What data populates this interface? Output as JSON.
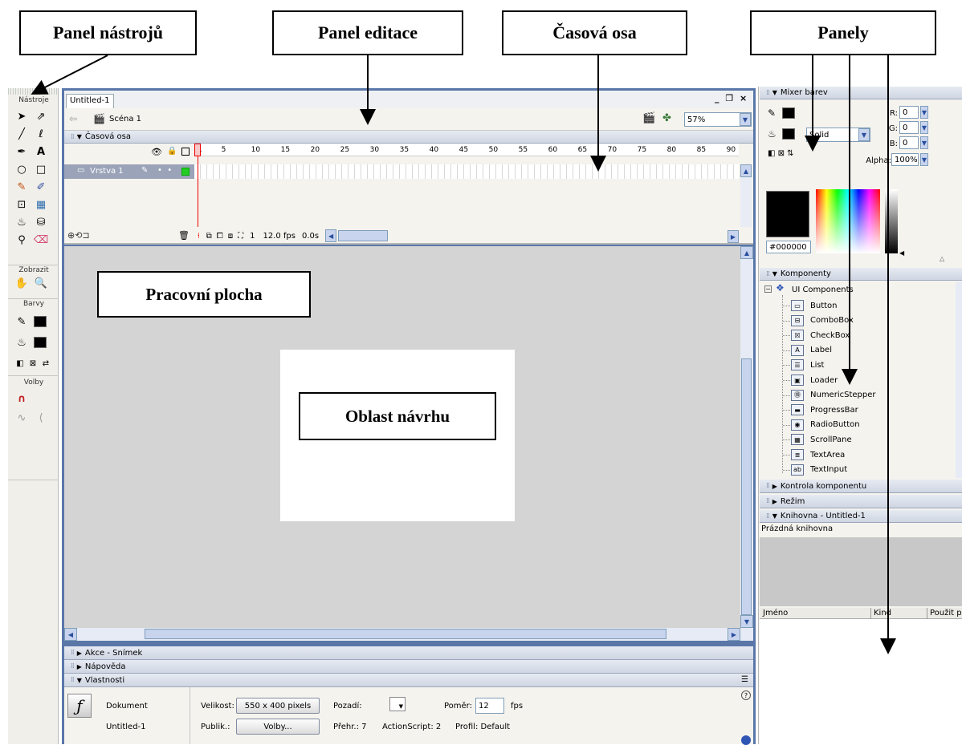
{
  "callouts": {
    "tools_panel": "Panel nástrojů",
    "edit_panel": "Panel editace",
    "timeline": "Časová osa",
    "panels": "Panely",
    "workspace": "Pracovní plocha",
    "design_area": "Oblast návrhu"
  },
  "toolbox": {
    "title": "Nástroje",
    "view_label": "Zobrazit",
    "colors_label": "Barvy",
    "options_label": "Volby"
  },
  "document": {
    "tab": "Untitled-1",
    "scene": "Scéna 1",
    "zoom": "57%",
    "window_controls": "_ ❐ ×"
  },
  "timeline": {
    "title": "Časová osa",
    "layer": "Vrstva 1",
    "frames": [
      "1",
      "5",
      "10",
      "15",
      "20",
      "25",
      "30",
      "35",
      "40",
      "45",
      "50",
      "55",
      "60",
      "65",
      "70",
      "75",
      "80",
      "85",
      "90"
    ],
    "current_frame": "1",
    "fps": "12.0 fps",
    "time": "0.0s"
  },
  "bottom_panels": {
    "actions": "Akce - Snímek",
    "help": "Nápověda",
    "properties": "Vlastnosti"
  },
  "properties": {
    "doc_label": "Dokument",
    "doc_name": "Untitled-1",
    "size_label": "Velikost:",
    "size_value": "550 x 400 pixels",
    "background_label": "Pozadí:",
    "ratio_label": "Poměr:",
    "ratio_value": "12",
    "fps_label": "fps",
    "publish_label": "Publik.:",
    "options_button": "Volby...",
    "player": "Přehr.: 7",
    "actionscript": "ActionScript: 2",
    "profile": "Profil:  Default"
  },
  "color_mixer": {
    "title": "Mixer barev",
    "fill_type": "Solid",
    "r_label": "R:",
    "r_value": "0",
    "g_label": "G:",
    "g_value": "0",
    "b_label": "B:",
    "b_value": "0",
    "alpha_label": "Alpha:",
    "alpha_value": "100%",
    "hex": "#000000"
  },
  "components": {
    "title": "Komponenty",
    "group": "UI Components",
    "items": [
      "Button",
      "ComboBox",
      "CheckBox",
      "Label",
      "List",
      "Loader",
      "NumericStepper",
      "ProgressBar",
      "RadioButton",
      "ScrollPane",
      "TextArea",
      "TextInput"
    ]
  },
  "right_panels": {
    "inspector": "Kontrola komponentu",
    "mode": "Režim",
    "library": "Knihovna - Untitled-1",
    "library_empty": "Prázdná knihovna",
    "col_name": "Jméno",
    "col_kind": "Kind",
    "col_usage": "Použit p"
  },
  "colors": {
    "stage_bg": "#d4d4d4",
    "panel_bg": "#f5f3ee",
    "accent": "#2f56b5"
  }
}
